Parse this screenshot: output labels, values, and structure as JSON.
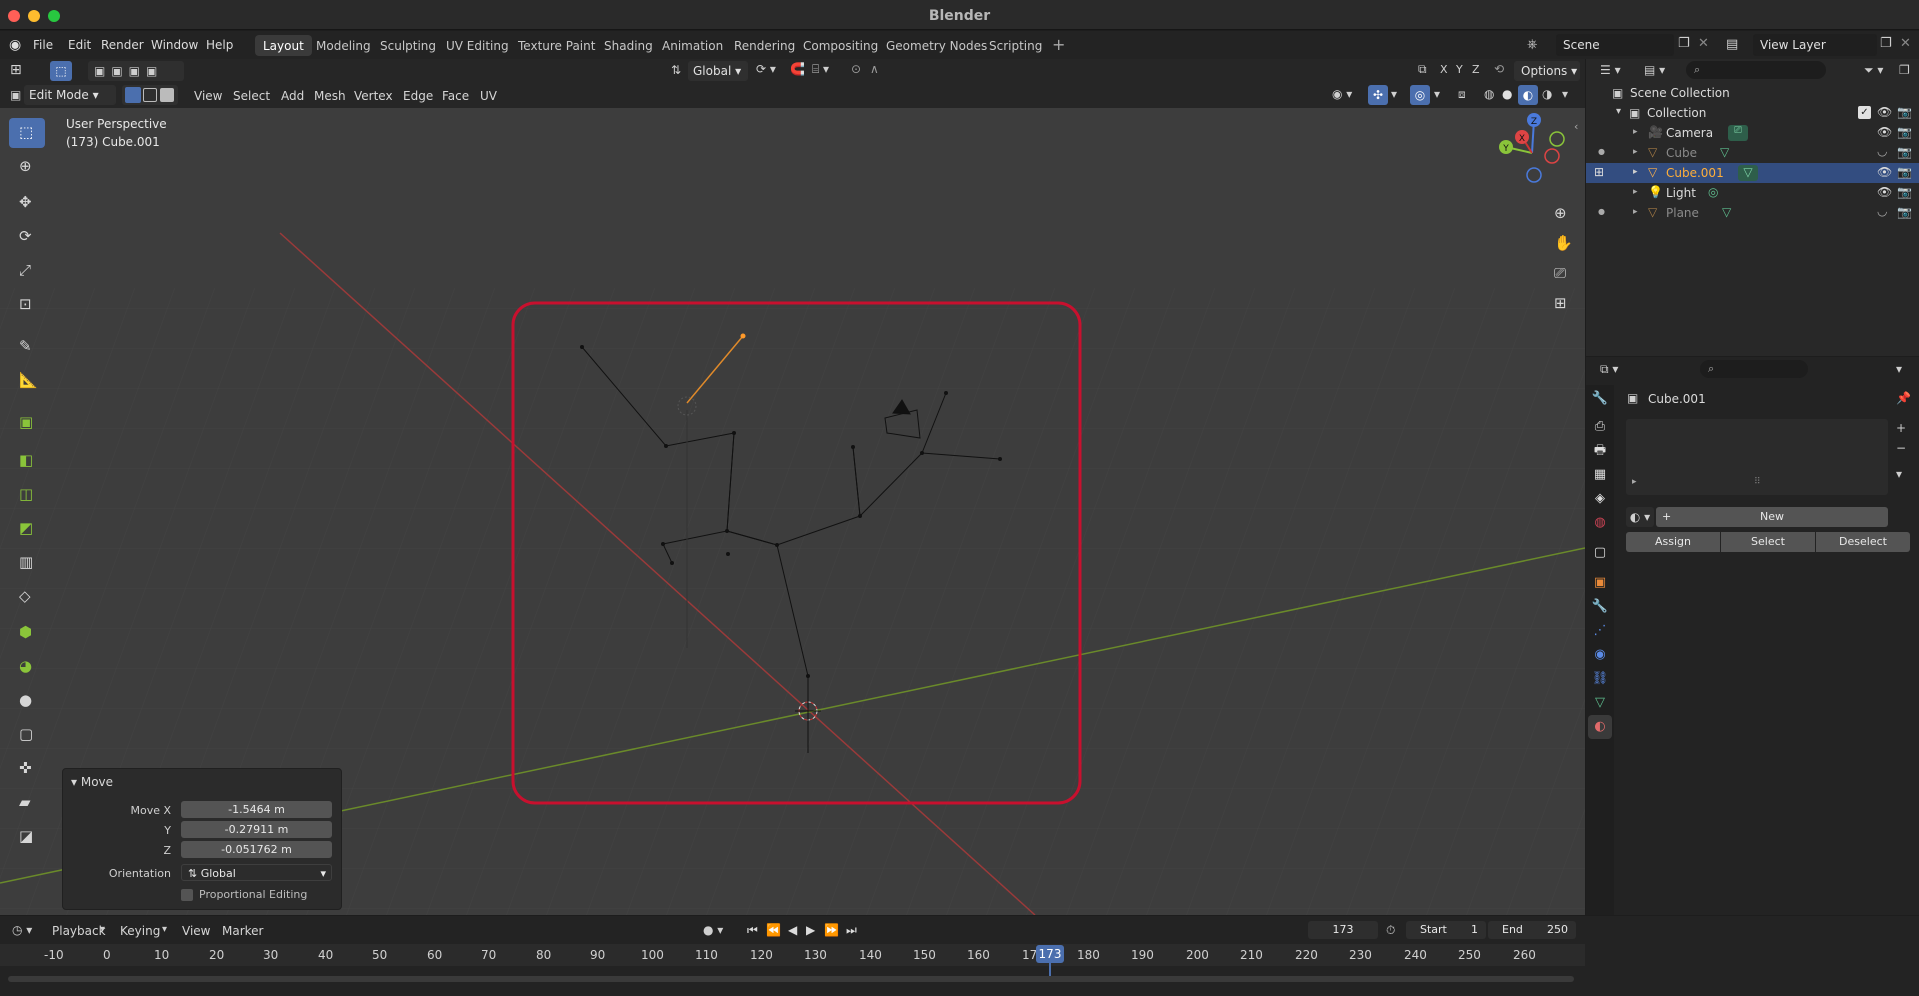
{
  "window": {
    "title": "Blender",
    "traffic_lights": [
      "#ff5f57",
      "#febc2e",
      "#28c840"
    ]
  },
  "menubar": {
    "items": [
      "File",
      "Edit",
      "Render",
      "Window",
      "Help"
    ]
  },
  "workspaces": {
    "tabs": [
      "Layout",
      "Modeling",
      "Sculpting",
      "UV Editing",
      "Texture Paint",
      "Shading",
      "Animation",
      "Rendering",
      "Compositing",
      "Geometry Nodes",
      "Scripting"
    ],
    "active": "Layout",
    "add_symbol": "+"
  },
  "scene": {
    "name": "Scene",
    "view_layer": "View Layer"
  },
  "header": {
    "orientation": "Global",
    "options_label": "Options",
    "axes": [
      "X",
      "Y",
      "Z"
    ]
  },
  "viewport_header": {
    "mode": "Edit Mode",
    "menus": [
      "View",
      "Select",
      "Add",
      "Mesh",
      "Vertex",
      "Edge",
      "Face",
      "UV"
    ]
  },
  "viewport": {
    "perspective_label": "User Perspective",
    "object_label": "(173) Cube.001",
    "highlight_color": "#c8102e",
    "gizmo": {
      "x": "X",
      "y": "Y",
      "z": "Z"
    }
  },
  "operator_panel": {
    "title": "Move",
    "fields": [
      {
        "label": "Move X",
        "value": "-1.5464 m"
      },
      {
        "label": "Y",
        "value": "-0.27911 m"
      },
      {
        "label": "Z",
        "value": "-0.051762 m"
      }
    ],
    "orientation_label": "Orientation",
    "orientation_value": "Global",
    "proportional_label": "Proportional Editing"
  },
  "outliner": {
    "root": "Scene Collection",
    "collection": "Collection",
    "items": [
      {
        "name": "Camera",
        "icon_color": "#e8a04a",
        "selected": false,
        "dim": false
      },
      {
        "name": "Cube",
        "icon_color": "#e8a04a",
        "selected": false,
        "dim": true
      },
      {
        "name": "Cube.001",
        "icon_color": "#e8a04a",
        "selected": true,
        "dim": false
      },
      {
        "name": "Light",
        "icon_color": "#e8a04a",
        "selected": false,
        "dim": false
      },
      {
        "name": "Plane",
        "icon_color": "#e8a04a",
        "selected": false,
        "dim": true
      }
    ]
  },
  "properties": {
    "object_name": "Cube.001",
    "new_button": "New",
    "buttons": [
      "Assign",
      "Select",
      "Deselect"
    ]
  },
  "timeline": {
    "menus": [
      "Playback",
      "Keying",
      "View",
      "Marker"
    ],
    "current_frame": "173",
    "start_label": "Start",
    "start_value": "1",
    "end_label": "End",
    "end_value": "250",
    "ruler": [
      "-10",
      "0",
      "10",
      "20",
      "30",
      "40",
      "50",
      "60",
      "70",
      "80",
      "90",
      "100",
      "110",
      "120",
      "130",
      "140",
      "150",
      "160",
      "17",
      "173",
      "180",
      "190",
      "200",
      "210",
      "220",
      "230",
      "240",
      "250",
      "260"
    ]
  }
}
